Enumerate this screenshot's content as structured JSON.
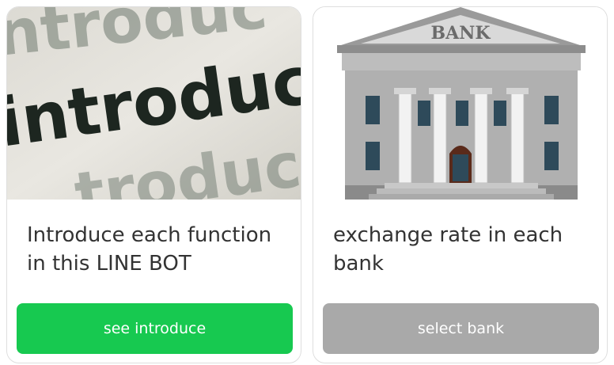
{
  "cards": [
    {
      "image": "introduce-word-photo",
      "image_text": "introduce",
      "title": "Introduce each function in this LINE BOT",
      "button": {
        "label": "see introduce",
        "color": "#17c950"
      }
    },
    {
      "image": "bank-building-illustration",
      "image_text": "BANK",
      "title": "exchange rate in each bank",
      "button": {
        "label": "select bank",
        "color": "#a9a9a9"
      }
    }
  ]
}
